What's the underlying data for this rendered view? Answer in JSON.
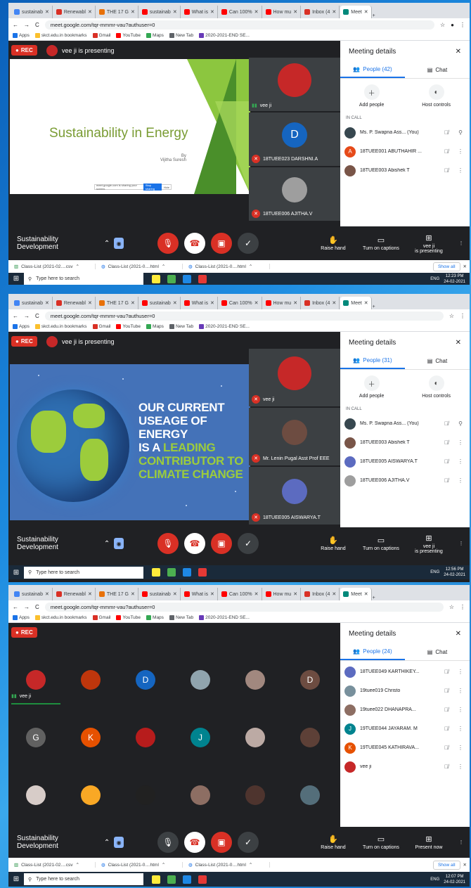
{
  "browser": {
    "tabs": [
      {
        "label": "sustainab",
        "color": "#4285f4"
      },
      {
        "label": "Renewabl",
        "color": "#d93025"
      },
      {
        "label": "THE 17 G",
        "color": "#e8710a"
      },
      {
        "label": "sustainab",
        "color": "#ff0000"
      },
      {
        "label": "What is",
        "color": "#ff0000"
      },
      {
        "label": "Can 100%",
        "color": "#ff0000"
      },
      {
        "label": "How mu",
        "color": "#ff0000"
      },
      {
        "label": "Inbox (4",
        "color": "#d93025"
      },
      {
        "label": "Meet",
        "color": "#00897b"
      }
    ],
    "url": "meet.google.com/tqr-mmmr-vau?authuser=0",
    "bookmarks": [
      "Apps",
      "skct.edu.in bookmarks",
      "Gmail",
      "YouTube",
      "Maps",
      "New Tab",
      "2020-2021-END SE..."
    ]
  },
  "meeting": {
    "title": "Sustainability Development",
    "rec_label": "REC",
    "presenting_text": "vee ji is presenting",
    "details_title": "Meeting details",
    "chat_label": "Chat",
    "add_people": "Add people",
    "host_controls": "Host controls",
    "in_call": "IN CALL",
    "raise_hand": "Raise hand",
    "captions": "Turn on captions",
    "present_now": "Present now",
    "presenter_line1": "vee ji",
    "presenter_line2": "is presenting"
  },
  "panel1": {
    "people_tab": "People (42)",
    "slide": {
      "title": "Sustainability in Energy",
      "by": "By",
      "author": "Vijitha Suresh",
      "bar_text": "meet.google.com is sharing your screen.",
      "stop": "Stop sharing",
      "hide": "Hide"
    },
    "tiles": [
      {
        "name": "vee ji",
        "muted": false,
        "avatar_color": "#c62828",
        "letter": ""
      },
      {
        "name": "18TUEE023 DARSHNI.A",
        "muted": true,
        "avatar_color": "#1565c0",
        "letter": "D"
      },
      {
        "name": "18TUEE006 AJITHA.V",
        "muted": true,
        "avatar_color": "#9e9e9e",
        "letter": ""
      }
    ],
    "people": [
      {
        "name": "Ms. P. Swapna Ass... (You)",
        "color": "#37474f",
        "letter": ""
      },
      {
        "name": "18TUEE001 ABUTHAHIR ...",
        "color": "#e64a19",
        "letter": "A"
      },
      {
        "name": "18TUEE003 Abishek T",
        "color": "#795548",
        "letter": ""
      }
    ],
    "downloads": [
      "Class-List (2021-02....csv",
      "Class-List (2021-0....html",
      "Class-List (2021-0....html"
    ],
    "show_all": "Show all",
    "time": "12:23 PM",
    "date": "24-02-2021"
  },
  "panel2": {
    "people_tab": "People (31)",
    "slide": {
      "line1": "OUR CURRENT",
      "line2": "USEAGE OF ENERGY",
      "line3a": "IS A ",
      "line3b": "LEADING",
      "line4": "CONTRIBUTOR TO",
      "line5": "CLIMATE CHANGE"
    },
    "tiles": [
      {
        "name": "vee ji",
        "muted": true,
        "avatar_color": "#c62828",
        "letter": ""
      },
      {
        "name": "Mr. Lenin Pugal Asst Prof EEE",
        "muted": true,
        "avatar_color": "#6d4c41",
        "letter": ""
      },
      {
        "name": "18TUEE005 AISWARYA.T",
        "muted": true,
        "avatar_color": "#5c6bc0",
        "letter": ""
      }
    ],
    "people": [
      {
        "name": "Ms. P. Swapna Ass... (You)",
        "color": "#37474f",
        "letter": ""
      },
      {
        "name": "18TUEE003 Abishek T",
        "color": "#795548",
        "letter": ""
      },
      {
        "name": "18TUEE005 AISWARYA.T",
        "color": "#5c6bc0",
        "letter": ""
      },
      {
        "name": "18TUEE006 AJITHA.V",
        "color": "#9e9e9e",
        "letter": ""
      }
    ],
    "time": "12:56 PM",
    "date": "24-02-2021"
  },
  "panel3": {
    "people_tab": "People (24)",
    "grid_first_name": "vee ji",
    "grid": [
      {
        "color": "#c62828",
        "letter": ""
      },
      {
        "color": "#bf360c",
        "letter": ""
      },
      {
        "color": "#1565c0",
        "letter": "D"
      },
      {
        "color": "#90a4ae",
        "letter": ""
      },
      {
        "color": "#a1887f",
        "letter": ""
      },
      {
        "color": "#6d4c41",
        "letter": "D"
      },
      {
        "color": "#616161",
        "letter": "G"
      },
      {
        "color": "#e65100",
        "letter": "K"
      },
      {
        "color": "#b71c1c",
        "letter": ""
      },
      {
        "color": "#00838f",
        "letter": "J"
      },
      {
        "color": "#bcaaa4",
        "letter": ""
      },
      {
        "color": "#5d4037",
        "letter": ""
      },
      {
        "color": "#d7ccc8",
        "letter": ""
      },
      {
        "color": "#f9a825",
        "letter": ""
      },
      {
        "color": "#212121",
        "letter": ""
      },
      {
        "color": "#8d6e63",
        "letter": ""
      },
      {
        "color": "#4e342e",
        "letter": ""
      },
      {
        "color": "#546e7a",
        "letter": ""
      }
    ],
    "people": [
      {
        "name": "18TUEE049 KARTHIKEY...",
        "color": "#5c6bc0",
        "letter": ""
      },
      {
        "name": "19tuee019 Christo",
        "color": "#78909c",
        "letter": ""
      },
      {
        "name": "19tuee022 DHANAPRA...",
        "color": "#8d6e63",
        "letter": ""
      },
      {
        "name": "19TUEE044 JAYARAM. M",
        "color": "#00838f",
        "letter": "J"
      },
      {
        "name": "19TUEE045 KATHIRAVA...",
        "color": "#e65100",
        "letter": "K"
      },
      {
        "name": "vee ji",
        "color": "#c62828",
        "letter": ""
      }
    ],
    "time": "12:07 PM",
    "date": "24-02-2021"
  },
  "taskbar": {
    "search_placeholder": "Type here to search",
    "lang": "ENG"
  }
}
